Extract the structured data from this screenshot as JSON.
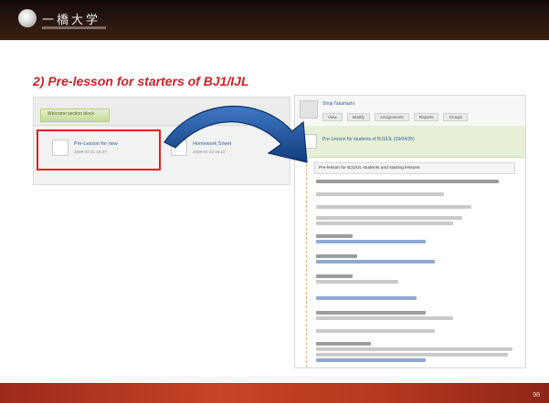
{
  "header": {
    "logo_text": "一橋大学"
  },
  "slide": {
    "title": "2) Pre-lesson for starters of BJ1/IJL",
    "page_number": "98"
  },
  "left_screenshot": {
    "section_label": "Welcome section block",
    "items": [
      {
        "title": "Pre-Lesson for new",
        "date": "2009-04-21 16:37"
      },
      {
        "title": "Homework Sheet",
        "date": "2009-04-22 15:10"
      }
    ]
  },
  "right_screenshot": {
    "user_name": "Shoji Takahashi",
    "tabs": [
      "View",
      "Modify",
      "Assignments",
      "Reports",
      "Groups"
    ],
    "green_bar_text": "Pre-Lesson for students of BJ1/IJL (09/04/25)",
    "section_title": "Pre-lesson for BJ1/IJL students and starting lessons"
  },
  "colors": {
    "title_red": "#d21f24",
    "highlight_red": "#e02020",
    "arrow_blue": "#1b4f9c",
    "bottom_band": "#c74426"
  }
}
